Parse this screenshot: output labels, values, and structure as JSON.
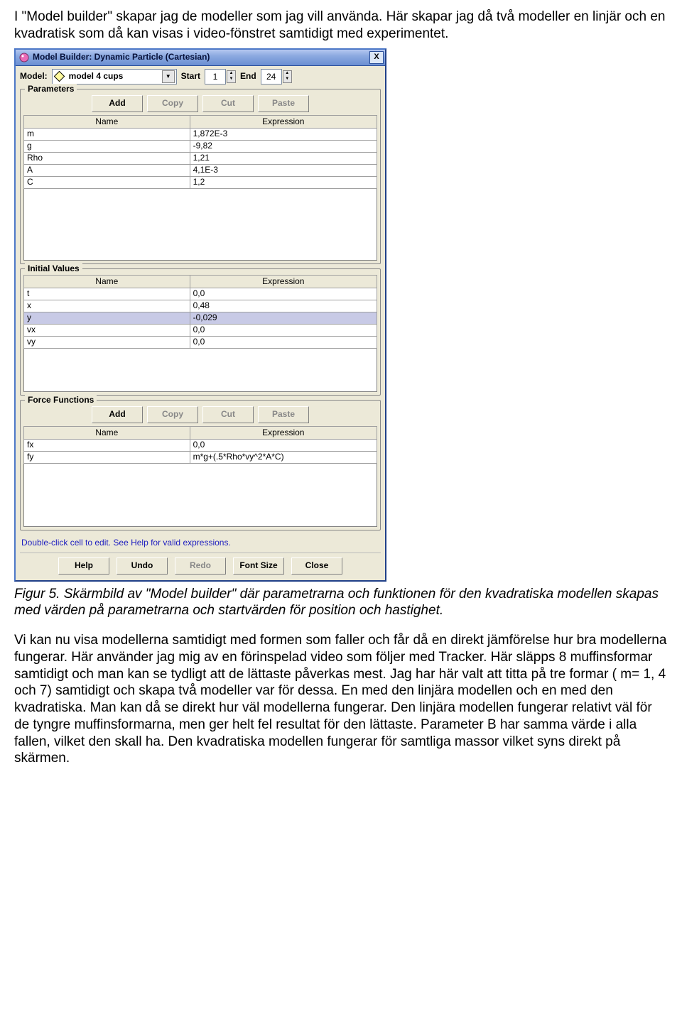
{
  "intro": "I \"Model builder\" skapar jag de modeller som jag vill använda. Här skapar jag då två modeller en linjär och en kvadratisk som då kan visas i video-fönstret samtidigt med experimentet.",
  "caption": "Figur 5. Skärmbild av \"Model builder\" där parametrarna och funktionen för den kvadratiska modellen skapas med värden på parametrarna och startvärden för position och hastighet.",
  "body": "Vi kan nu visa modellerna samtidigt med formen som faller och får då en direkt jämförelse hur bra modellerna fungerar. Här använder jag mig av en förinspelad video som följer med Tracker. Här släpps 8 muffinsformar samtidigt och man kan se tydligt att de lättaste påverkas mest. Jag har här valt att titta på tre formar ( m= 1, 4 och 7) samtidigt och skapa två modeller var för dessa. En med den linjära modellen och en med den kvadratiska. Man kan då se direkt hur väl modellerna fungerar. Den linjära modellen fungerar relativt väl för de tyngre muffinsformarna, men ger helt fel resultat för den lättaste. Parameter B har samma värde i alla fallen, vilket den skall ha. Den kvadratiska modellen fungerar för samtliga massor vilket syns direkt på skärmen.",
  "mb": {
    "title": "Model Builder: Dynamic Particle (Cartesian)",
    "close": "X",
    "model_label": "Model:",
    "model_value": "model 4 cups",
    "start_label": "Start",
    "start_value": "1",
    "end_label": "End",
    "end_value": "24",
    "group_params": "Parameters",
    "group_initial": "Initial Values",
    "group_force": "Force Functions",
    "btn_add": "Add",
    "btn_copy": "Copy",
    "btn_cut": "Cut",
    "btn_paste": "Paste",
    "col_name": "Name",
    "col_expr": "Expression",
    "params": [
      {
        "name": "m",
        "expr": "1,872E-3"
      },
      {
        "name": "g",
        "expr": "-9,82"
      },
      {
        "name": "Rho",
        "expr": "1,21"
      },
      {
        "name": "A",
        "expr": "4,1E-3"
      },
      {
        "name": "C",
        "expr": "1,2"
      }
    ],
    "initials": [
      {
        "name": "t",
        "expr": "0,0"
      },
      {
        "name": "x",
        "expr": "0,48"
      },
      {
        "name": "y",
        "expr": "-0,029"
      },
      {
        "name": "vx",
        "expr": "0,0"
      },
      {
        "name": "vy",
        "expr": "0,0"
      }
    ],
    "forces": [
      {
        "name": "fx",
        "expr": "0,0"
      },
      {
        "name": "fy",
        "expr": "m*g+(.5*Rho*vy^2*A*C)"
      }
    ],
    "hint": "Double-click cell to edit. See Help for valid expressions.",
    "btn_help": "Help",
    "btn_undo": "Undo",
    "btn_redo": "Redo",
    "btn_fontsize": "Font Size",
    "btn_close": "Close"
  }
}
